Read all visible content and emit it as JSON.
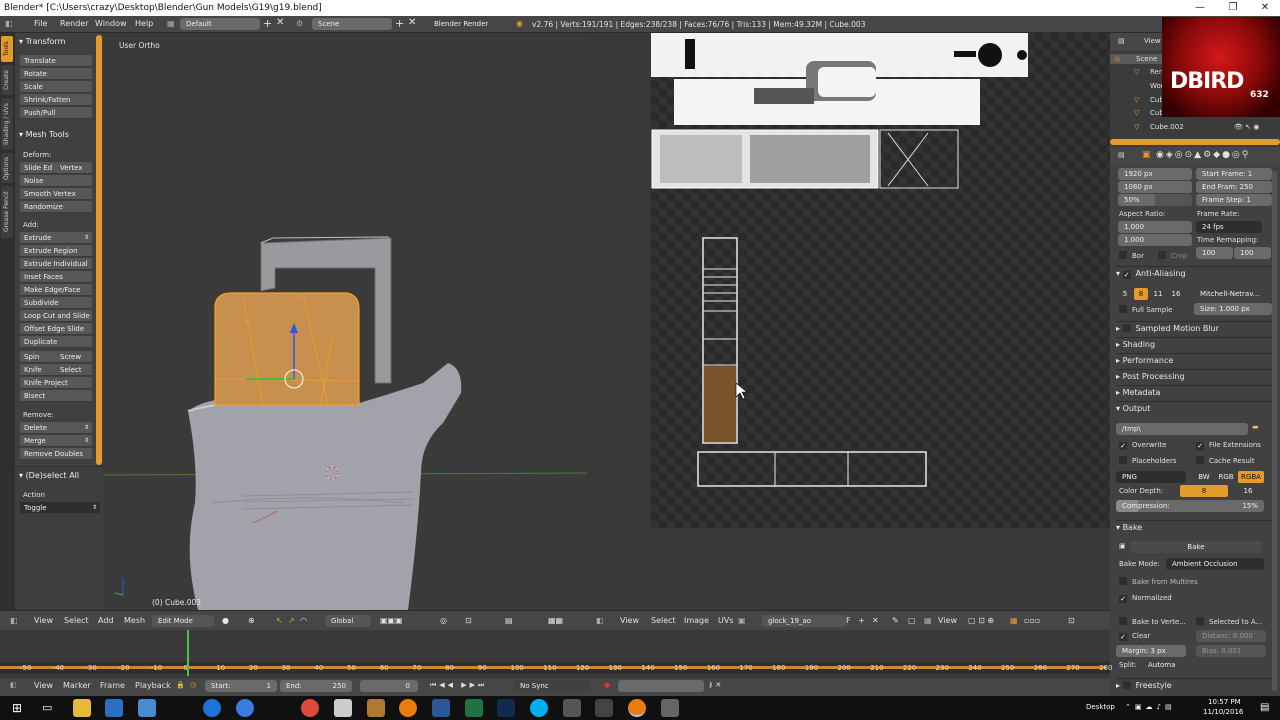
{
  "window": {
    "title": "Blender* [C:\\Users\\crazy\\Desktop\\Blender\\Gun Models\\G19\\g19.blend]",
    "controls": [
      "—",
      "❐",
      "✕"
    ]
  },
  "menubar": {
    "items": [
      "File",
      "Render",
      "Window",
      "Help"
    ],
    "screen_layout": "Default",
    "scene": "Scene",
    "engine": "Blender Render",
    "stats": "v2.76 | Verts:191/191 | Edges:238/238 | Faces:76/76 | Tris:133 | Mem:49.32M | Cube.003"
  },
  "left_tabs": [
    "Tools",
    "Create",
    "Shading / UVs",
    "Options",
    "Grease Pencil"
  ],
  "tool_shelf": {
    "transform_header": "Transform",
    "transform": [
      "Translate",
      "Rotate",
      "Scale",
      "Shrink/Fatten",
      "Push/Pull"
    ],
    "mesh_tools_header": "Mesh Tools",
    "deform_label": "Deform:",
    "deform_row1": [
      "Slide Ed",
      "Vertex"
    ],
    "deform": [
      "Noise",
      "Smooth Vertex",
      "Randomize"
    ],
    "add_label": "Add:",
    "add": [
      "Extrude",
      "Extrude Region",
      "Extrude Individual",
      "Inset Faces",
      "Make Edge/Face",
      "Subdivide",
      "Loop Cut and Slide",
      "Offset Edge Slide",
      "Duplicate"
    ],
    "spin_row": [
      "Spin",
      "Screw"
    ],
    "knife_row": [
      "Knife",
      "Select"
    ],
    "knife_more": [
      "Knife Project",
      "Bisect"
    ],
    "remove_label": "Remove:",
    "remove": [
      "Delete",
      "Merge",
      "Remove Doubles"
    ],
    "operator_header": "(De)select All",
    "action_label": "Action",
    "action_value": "Toggle"
  },
  "viewport": {
    "view_label": "User Ortho",
    "object_label": "(0) Cube.003",
    "header": [
      "View",
      "Select",
      "Add",
      "Mesh"
    ],
    "mode": "Edit Mode",
    "orientation": "Global"
  },
  "uv_editor": {
    "header": [
      "View",
      "Select",
      "Image",
      "UVs"
    ],
    "image_name": "glock_19_ao",
    "image_slot": "F",
    "view2": "View"
  },
  "outliner": {
    "header": "View",
    "items": [
      "Scene",
      "Ren",
      "Wor",
      "Cub",
      "Cub",
      "Cube.002"
    ],
    "logo_text": "DBIRD",
    "logo_sub": "632"
  },
  "properties": {
    "res_x": "1920 px",
    "res_y": "1080 px",
    "res_pct": "50%",
    "start_frame": "Start Frame: 1",
    "end_frame": "End Fram: 250",
    "frame_step": "Frame Step: 1",
    "aspect_label": "Aspect Ratio:",
    "aspect_x": "1.000",
    "aspect_y": "1.000",
    "frame_rate_label": "Frame Rate:",
    "frame_rate": "24 fps",
    "time_remap_label": "Time Remapping:",
    "time_remap": [
      "100",
      "100"
    ],
    "bor": "Bor",
    "crop": "Crop",
    "aa_header": "Anti-Aliasing",
    "aa_samples": [
      "5",
      "8",
      "11",
      "16"
    ],
    "aa_filter": "Mitchell-Netrav...",
    "full_sample": "Full Sample",
    "aa_size": "Size: 1.000 px",
    "panels": [
      "Sampled Motion Blur",
      "Shading",
      "Performance",
      "Post Processing",
      "Metadata"
    ],
    "output_header": "Output",
    "output_path": "/tmp\\",
    "overwrite": "Overwrite",
    "file_ext": "File Extensions",
    "placeholders": "Placeholders",
    "cache_result": "Cache Result",
    "format": "PNG",
    "color_modes": [
      "BW",
      "RGB",
      "RGBA"
    ],
    "color_depth_label": "Color Depth:",
    "color_depth": [
      "8",
      "16"
    ],
    "compression": "Compression:",
    "compression_value": "15%",
    "bake_header": "Bake",
    "bake_button": "Bake",
    "bake_mode_label": "Bake Mode:",
    "bake_mode": "Ambient Occlusion",
    "bake_multires": "Bake from Multires",
    "normalized": "Normalized",
    "bake_to_vertex": "Bake to Verte...",
    "selected_to_active": "Selected to A...",
    "clear": "Clear",
    "distance": "Distanc: 0.000",
    "margin": "Margin: 3 px",
    "bias": "Bias: 0.001",
    "split_label": "Split:",
    "split": "Automa",
    "freestyle": "Freestyle"
  },
  "timeline": {
    "ticks": [
      "-50",
      "-40",
      "-30",
      "-20",
      "-10",
      "0",
      "10",
      "20",
      "30",
      "40",
      "50",
      "60",
      "70",
      "80",
      "90",
      "100",
      "110",
      "120",
      "130",
      "140",
      "150",
      "160",
      "170",
      "180",
      "190",
      "200",
      "210",
      "220",
      "230",
      "240",
      "250",
      "260",
      "270",
      "280"
    ],
    "header": [
      "View",
      "Marker",
      "Frame",
      "Playback"
    ],
    "start": "Start:",
    "start_value": "1",
    "end": "End:",
    "end_value": "250",
    "current": "0",
    "sync": "No Sync"
  },
  "taskbar": {
    "desktop": "Desktop",
    "time": "10:57 PM",
    "date": "11/10/2016"
  }
}
